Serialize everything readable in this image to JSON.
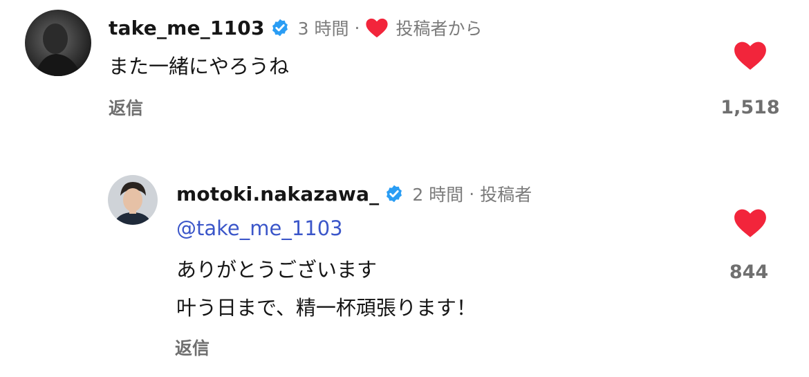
{
  "comments": [
    {
      "username": "take_me_1103",
      "time": "3 時間",
      "separator": "·",
      "author_note": "投稿者から",
      "text": "また一緒にやろうね",
      "reply_label": "返信",
      "like_count": "1,518"
    },
    {
      "username": "motoki.nakazawa_",
      "time": "2 時間",
      "separator": "·",
      "author_note": "投稿者",
      "mention": "@take_me_1103",
      "lines": [
        "ありがとうございます",
        "叶う日まで、精一杯頑張ります！"
      ],
      "reply_label": "返信",
      "like_count": "844"
    }
  ],
  "colors": {
    "heart": "#f2253b",
    "verified": "#2a9df4",
    "mention": "#3b56c9",
    "meta_gray": "#7b7b7b"
  },
  "icons": {
    "verified": "verified-badge-icon",
    "like": "heart-icon",
    "creator_liked": "heart-icon"
  }
}
